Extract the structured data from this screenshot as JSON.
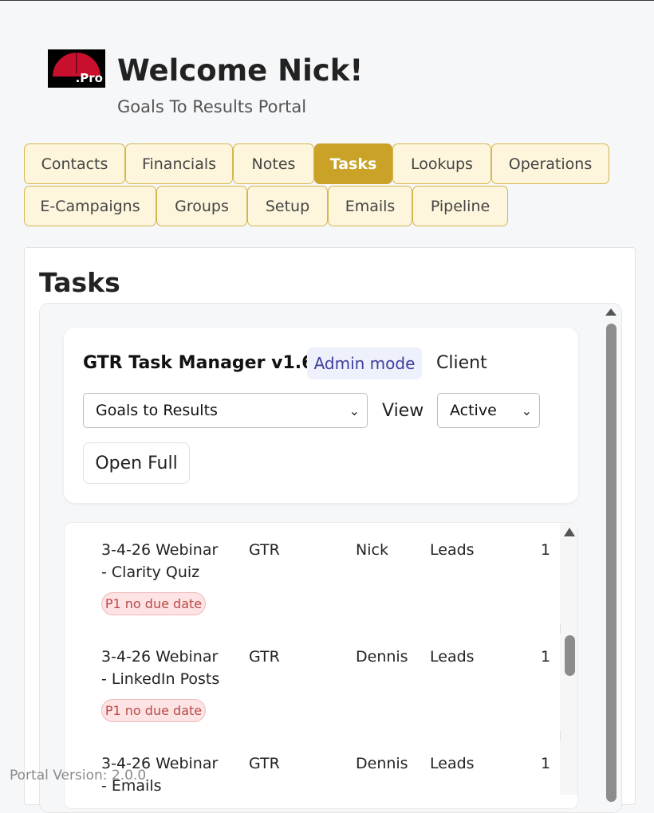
{
  "header": {
    "logo_text": ".Pro",
    "welcome": "Welcome Nick!",
    "subtitle": "Goals To Results Portal"
  },
  "tabs": [
    {
      "label": "Contacts",
      "active": false
    },
    {
      "label": "Financials",
      "active": false
    },
    {
      "label": "Notes",
      "active": false
    },
    {
      "label": "Tasks",
      "active": true
    },
    {
      "label": "Lookups",
      "active": false
    },
    {
      "label": "Operations",
      "active": false
    },
    {
      "label": "E-Campaigns",
      "active": false
    },
    {
      "label": "Groups",
      "active": false
    },
    {
      "label": "Setup",
      "active": false
    },
    {
      "label": "Emails",
      "active": false
    },
    {
      "label": "Pipeline",
      "active": false
    }
  ],
  "panel": {
    "title": "Tasks"
  },
  "task_manager": {
    "title": "GTR Task Manager v1.6",
    "mode_badge": "Admin mode",
    "client_label": "Client",
    "client_select": "Goals to Results",
    "view_label": "View",
    "view_select": "Active",
    "open_full_label": "Open Full"
  },
  "tasks": [
    {
      "name_line1": "3-4-26 Webinar",
      "name_line2": "- Clarity Quiz",
      "company": "GTR",
      "owner": "Nick",
      "category": "Leads",
      "extra": "1",
      "badge": "P1 no due date"
    },
    {
      "name_line1": "3-4-26 Webinar",
      "name_line2": "- LinkedIn Posts",
      "company": "GTR",
      "owner": "Dennis",
      "category": "Leads",
      "extra": "1",
      "badge": "P1 no due date"
    },
    {
      "name_line1": "3-4-26 Webinar",
      "name_line2": "- Emails",
      "company": "GTR",
      "owner": "Dennis",
      "category": "Leads",
      "extra": "1",
      "badge": ""
    }
  ],
  "footer": {
    "version": "Portal Version: 2.0.0"
  },
  "colors": {
    "accent": "#c9a227",
    "tab_bg": "#fdf6dc",
    "badge_bg": "#fde3e3",
    "badge_text": "#b84a4a",
    "admin_badge_bg": "#eef0fb",
    "logo_red": "#c8102e"
  }
}
